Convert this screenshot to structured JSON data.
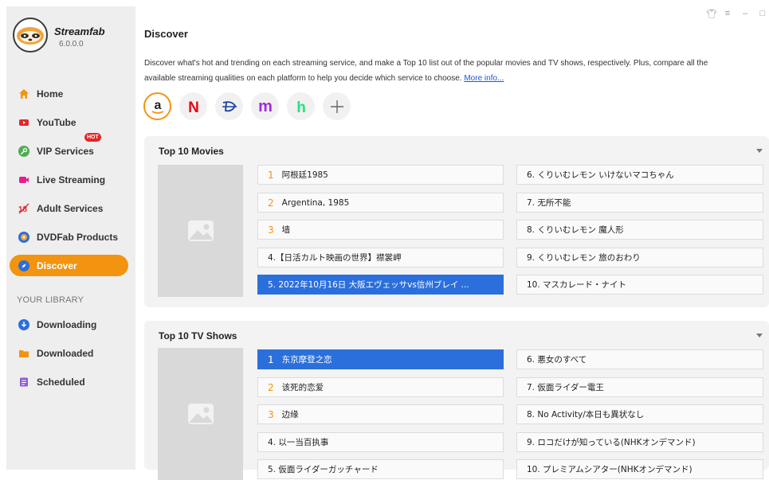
{
  "app": {
    "name": "Streamfab",
    "version": "6.0.0.0"
  },
  "sidebar": {
    "items": [
      {
        "label": "Home",
        "icon": "home-icon",
        "color": "#f29410"
      },
      {
        "label": "YouTube",
        "icon": "youtube-icon",
        "color": "#e5252a"
      },
      {
        "label": "VIP Services",
        "icon": "key-icon",
        "color": "#4caf50",
        "badge": "HOT"
      },
      {
        "label": "Live Streaming",
        "icon": "live-icon",
        "color": "#e91e8c"
      },
      {
        "label": "Adult Services",
        "icon": "adult-icon",
        "color": "#e5252a"
      },
      {
        "label": "DVDFab Products",
        "icon": "dvdfab-icon",
        "color": "#2b6fdc"
      },
      {
        "label": "Discover",
        "icon": "compass-icon",
        "color": "#ffffff",
        "active": true
      }
    ],
    "library_title": "YOUR LIBRARY",
    "library": [
      {
        "label": "Downloading",
        "icon": "download-icon",
        "color": "#2b6fdc"
      },
      {
        "label": "Downloaded",
        "icon": "folder-icon",
        "color": "#f29410"
      },
      {
        "label": "Scheduled",
        "icon": "schedule-icon",
        "color": "#8e5bd6"
      }
    ]
  },
  "main": {
    "title": "Discover",
    "description_line1": "Discover what's hot and trending on each streaming service, and make a Top 10 list out of the popular movies and TV shows, respectively. Plus, compare all the",
    "description_line2": "available streaming qualities on each platform to help you decide which service to choose.",
    "more_info": "More info...",
    "services": [
      {
        "name": "amazon-icon",
        "glyph": "a",
        "color": "#222222",
        "active": true
      },
      {
        "name": "netflix-icon",
        "glyph": "N",
        "color": "#e50914"
      },
      {
        "name": "disney-icon",
        "glyph": "D",
        "color": "#1a3ea8"
      },
      {
        "name": "max-icon",
        "glyph": "m",
        "color": "#a02bdc"
      },
      {
        "name": "hulu-icon",
        "glyph": "h",
        "color": "#1ce783"
      },
      {
        "name": "add-icon",
        "glyph": "+",
        "color": "#666666"
      }
    ],
    "movies": {
      "title": "Top 10 Movies",
      "left": [
        {
          "num": "1",
          "text": "阿根廷1985"
        },
        {
          "num": "2",
          "text": "Argentina, 1985"
        },
        {
          "num": "3",
          "text": "墙"
        },
        {
          "num": "",
          "text": "4.【日活カルト映画の世界】襟裳岬"
        },
        {
          "num": "",
          "text": "5. 2022年10月16日 大阪エヴェッサvs信州ブレイ ...",
          "selected": true
        }
      ],
      "right": [
        {
          "text": "6. くりいむレモン いけないマコちゃん"
        },
        {
          "text": "7. 无所不能"
        },
        {
          "text": "8. くりいむレモン 魔人形"
        },
        {
          "text": "9. くりいむレモン 旅のおわり"
        },
        {
          "text": "10. マスカレード・ナイト"
        }
      ]
    },
    "shows": {
      "title": "Top 10 TV Shows",
      "left": [
        {
          "num": "1",
          "text": "东京摩登之恋",
          "selected": true
        },
        {
          "num": "2",
          "text": "该死的恋爱"
        },
        {
          "num": "3",
          "text": "边缘"
        },
        {
          "num": "",
          "text": "4. 以一当百执事"
        },
        {
          "num": "",
          "text": "5. 仮面ライダーガッチャード"
        }
      ],
      "right": [
        {
          "text": "6. 悪女のすべて"
        },
        {
          "text": "7. 仮面ライダー電王"
        },
        {
          "text": "8. No Activity/本日も異状なし"
        },
        {
          "text": "9. ロコだけが知っている(NHKオンデマンド)"
        },
        {
          "text": "10. プレミアムシアター(NHKオンデマンド)"
        }
      ]
    }
  }
}
